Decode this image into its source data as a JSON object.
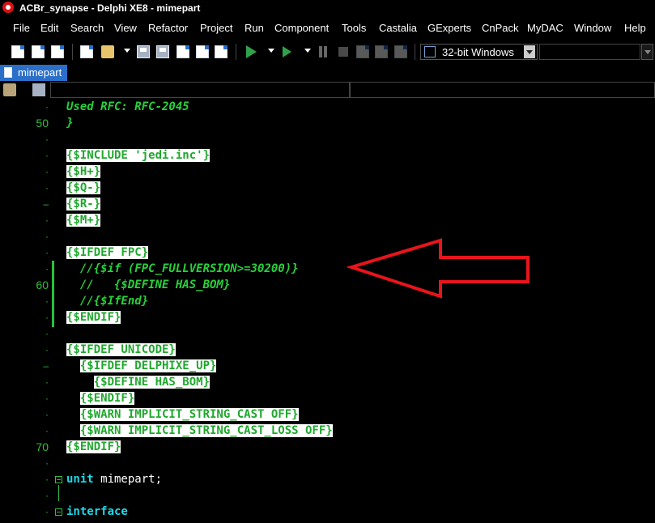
{
  "window": {
    "title": "ACBr_synapse - Delphi XE8 - mimepart"
  },
  "menu": [
    "File",
    "Edit",
    "Search",
    "View",
    "Refactor",
    "Project",
    "Run",
    "Component",
    "Tools",
    "Castalia",
    "GExperts",
    "CnPack",
    "MyDAC",
    "Window",
    "Help"
  ],
  "toolbar": {
    "platform": "32-bit Windows"
  },
  "tabs": [
    {
      "label": "mimepart"
    }
  ],
  "editor": {
    "lines": [
      {
        "gutter": "·",
        "segments": [
          {
            "t": "Used RFC: RFC-2045",
            "c": "cm"
          }
        ]
      },
      {
        "gutter": "50",
        "segments": [
          {
            "t": "}",
            "c": "cm"
          }
        ]
      },
      {
        "gutter": "·",
        "segments": []
      },
      {
        "gutter": "·",
        "segments": [
          {
            "t": "{$INCLUDE 'jedi.inc'}",
            "c": "hl"
          }
        ]
      },
      {
        "gutter": "·",
        "segments": [
          {
            "t": "{$H+}",
            "c": "hl"
          }
        ]
      },
      {
        "gutter": "·",
        "segments": [
          {
            "t": "{$Q-}",
            "c": "hl"
          }
        ]
      },
      {
        "gutter": "–",
        "segments": [
          {
            "t": "{$R-}",
            "c": "hl"
          }
        ]
      },
      {
        "gutter": "·",
        "segments": [
          {
            "t": "{$M+}",
            "c": "hl"
          }
        ]
      },
      {
        "gutter": "·",
        "segments": []
      },
      {
        "gutter": "·",
        "segments": [
          {
            "t": "{$IFDEF FPC}",
            "c": "hl"
          }
        ]
      },
      {
        "gutter": "·",
        "segments": [
          {
            "t": "  //{$if (FPC_FULLVERSION>=30200)}",
            "c": "cm"
          }
        ]
      },
      {
        "gutter": "60",
        "segments": [
          {
            "t": "  //   {$DEFINE HAS_BOM}",
            "c": "cm"
          }
        ]
      },
      {
        "gutter": "·",
        "segments": [
          {
            "t": "  //{$IfEnd}",
            "c": "cm"
          }
        ]
      },
      {
        "gutter": "·",
        "segments": [
          {
            "t": "{$ENDIF}",
            "c": "hl"
          }
        ]
      },
      {
        "gutter": "·",
        "segments": []
      },
      {
        "gutter": "·",
        "segments": [
          {
            "t": "{$IFDEF UNICODE}",
            "c": "hl"
          }
        ]
      },
      {
        "gutter": "–",
        "segments": [
          {
            "t": "  ",
            "c": "txt"
          },
          {
            "t": "{$IFDEF DELPHIXE_UP}",
            "c": "hl"
          }
        ]
      },
      {
        "gutter": "·",
        "segments": [
          {
            "t": "    ",
            "c": "txt"
          },
          {
            "t": "{$DEFINE HAS_BOM}",
            "c": "hl"
          }
        ]
      },
      {
        "gutter": "·",
        "segments": [
          {
            "t": "  ",
            "c": "txt"
          },
          {
            "t": "{$ENDIF}",
            "c": "hl"
          }
        ]
      },
      {
        "gutter": "·",
        "segments": [
          {
            "t": "  ",
            "c": "txt"
          },
          {
            "t": "{$WARN IMPLICIT_STRING_CAST OFF}",
            "c": "hl"
          }
        ]
      },
      {
        "gutter": "·",
        "segments": [
          {
            "t": "  ",
            "c": "txt"
          },
          {
            "t": "{$WARN IMPLICIT_STRING_CAST_LOSS OFF}",
            "c": "hl"
          }
        ]
      },
      {
        "gutter": "70",
        "segments": [
          {
            "t": "{$ENDIF}",
            "c": "hl"
          }
        ]
      },
      {
        "gutter": "·",
        "segments": []
      },
      {
        "gutter": "·",
        "segments": [
          {
            "t": "unit",
            "c": "kw"
          },
          {
            "t": " mimepart;",
            "c": "txt"
          }
        ]
      },
      {
        "gutter": "·",
        "segments": []
      },
      {
        "gutter": "·",
        "segments": [
          {
            "t": "interface",
            "c": "kw"
          }
        ]
      }
    ]
  },
  "colors": {
    "tab_active": "#2b6fc9",
    "annotation_arrow": "#e8141c",
    "change_bar": "#22c33c"
  }
}
